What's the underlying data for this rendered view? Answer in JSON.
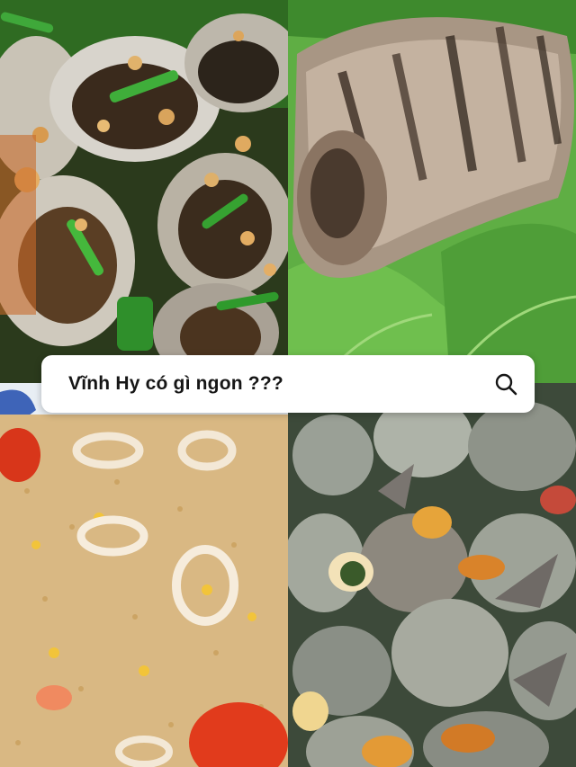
{
  "search": {
    "query": "Vĩnh Hy có gì ngon ???",
    "icon": "search-icon"
  },
  "tiles": [
    {
      "position": "top-left",
      "content": "grilled-oysters-photo"
    },
    {
      "position": "top-right",
      "content": "grilled-fish-photo"
    },
    {
      "position": "bottom-left",
      "content": "squid-fried-rice-photo"
    },
    {
      "position": "bottom-right",
      "content": "sea-snails-photo"
    }
  ],
  "colors": {
    "search_bg": "#ffffff",
    "search_text": "#161616",
    "leaf_green": "#3f8a2e"
  }
}
